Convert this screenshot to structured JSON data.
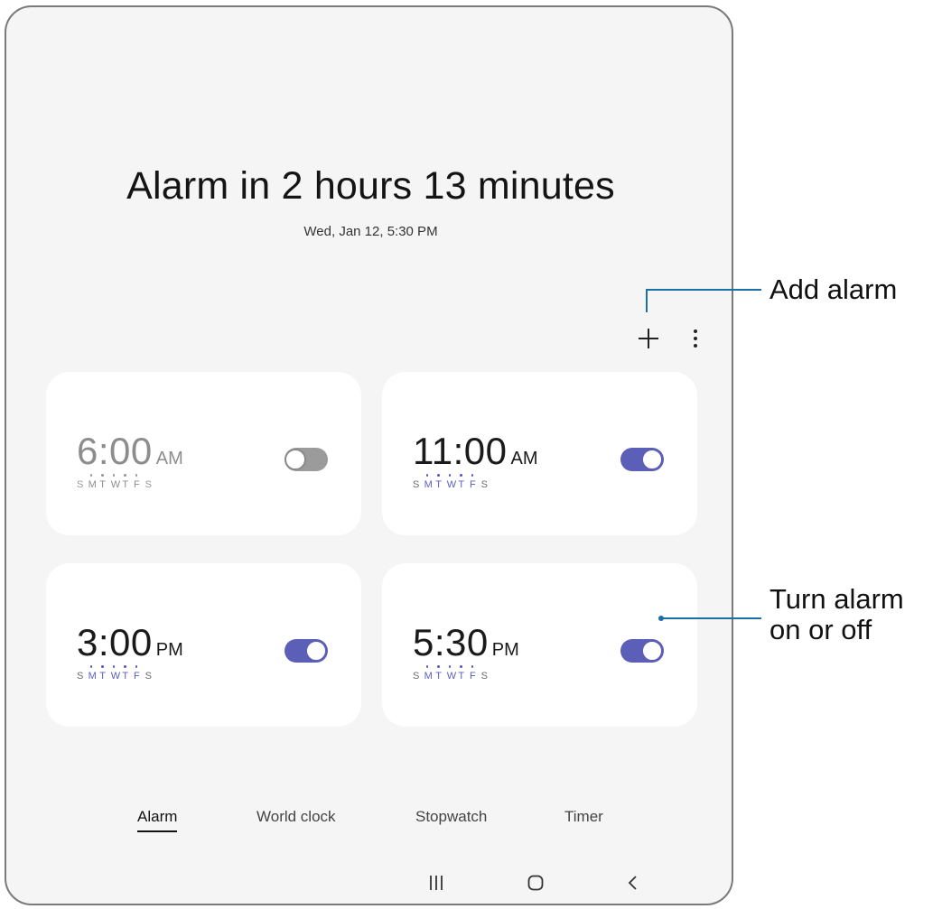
{
  "alarm_screen": {
    "headline": "Alarm in 2 hours 13 minutes",
    "next_alarm_date": "Wed, Jan 12, 5:30 PM"
  },
  "toolbar": {
    "add_icon": "plus-icon",
    "more_icon": "more-vertical-icon"
  },
  "alarms": [
    {
      "time": "6:00",
      "period": "AM",
      "enabled": false,
      "days": [
        "S",
        "M",
        "T",
        "W",
        "T",
        "F",
        "S"
      ],
      "selected_days": [
        1,
        2,
        3,
        4,
        5
      ]
    },
    {
      "time": "11:00",
      "period": "AM",
      "enabled": true,
      "days": [
        "S",
        "M",
        "T",
        "W",
        "T",
        "F",
        "S"
      ],
      "selected_days": [
        1,
        2,
        3,
        4,
        5
      ]
    },
    {
      "time": "3:00",
      "period": "PM",
      "enabled": true,
      "days": [
        "S",
        "M",
        "T",
        "W",
        "T",
        "F",
        "S"
      ],
      "selected_days": [
        1,
        2,
        3,
        4,
        5
      ]
    },
    {
      "time": "5:30",
      "period": "PM",
      "enabled": true,
      "days": [
        "S",
        "M",
        "T",
        "W",
        "T",
        "F",
        "S"
      ],
      "selected_days": [
        1,
        2,
        3,
        4,
        5
      ]
    }
  ],
  "tabs": [
    {
      "label": "Alarm",
      "active": true
    },
    {
      "label": "World clock",
      "active": false
    },
    {
      "label": "Stopwatch",
      "active": false
    },
    {
      "label": "Timer",
      "active": false
    }
  ],
  "navigation_bar": {
    "recents_icon": "recents-icon",
    "home_icon": "home-icon",
    "back_icon": "back-icon"
  },
  "callouts": {
    "add_alarm": "Add alarm",
    "turn_alarm_line1": "Turn alarm",
    "turn_alarm_line2": "on or off"
  },
  "colors": {
    "accent": "#5b5fb7",
    "toggle_off": "#9b9b9b",
    "screen_background": "#f5f5f5",
    "card_background": "#ffffff"
  }
}
